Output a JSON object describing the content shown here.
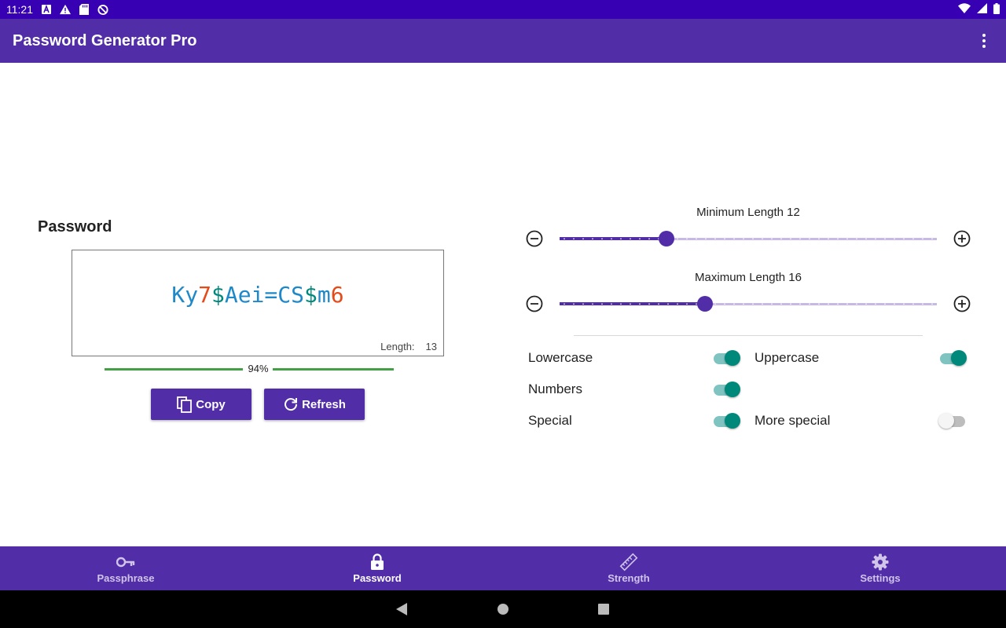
{
  "status_bar": {
    "time": "11:21"
  },
  "app_bar": {
    "title": "Password Generator Pro"
  },
  "password_panel": {
    "heading": "Password",
    "password_segments": [
      {
        "text": "Ky",
        "color": "#1e88c8"
      },
      {
        "text": "7",
        "color": "#e64a19"
      },
      {
        "text": "$",
        "color": "#00897b"
      },
      {
        "text": "Aei=CS",
        "color": "#1e88c8"
      },
      {
        "text": "$",
        "color": "#00897b"
      },
      {
        "text": "m",
        "color": "#1e88c8"
      },
      {
        "text": "6",
        "color": "#e64a19"
      }
    ],
    "length_label": "Length:",
    "length_value": "13",
    "strength_percent": 94,
    "strength_label": "94%",
    "copy_label": "Copy",
    "refresh_label": "Refresh"
  },
  "sliders": {
    "min": {
      "label": "Minimum Length 12",
      "fraction": 0.284
    },
    "max": {
      "label": "Maximum Length 16",
      "fraction": 0.386
    }
  },
  "options": {
    "lowercase": {
      "label": "Lowercase",
      "on": true
    },
    "uppercase": {
      "label": "Uppercase",
      "on": true
    },
    "numbers": {
      "label": "Numbers",
      "on": true
    },
    "special": {
      "label": "Special",
      "on": true
    },
    "more_special": {
      "label": "More special",
      "on": false
    }
  },
  "bottom_nav": {
    "passphrase": "Passphrase",
    "password": "Password",
    "strength": "Strength",
    "settings": "Settings"
  },
  "colors": {
    "primary": "#512da8",
    "status_bar": "#3700b3",
    "accent": "#00897b",
    "strength_bar": "#43a047"
  }
}
